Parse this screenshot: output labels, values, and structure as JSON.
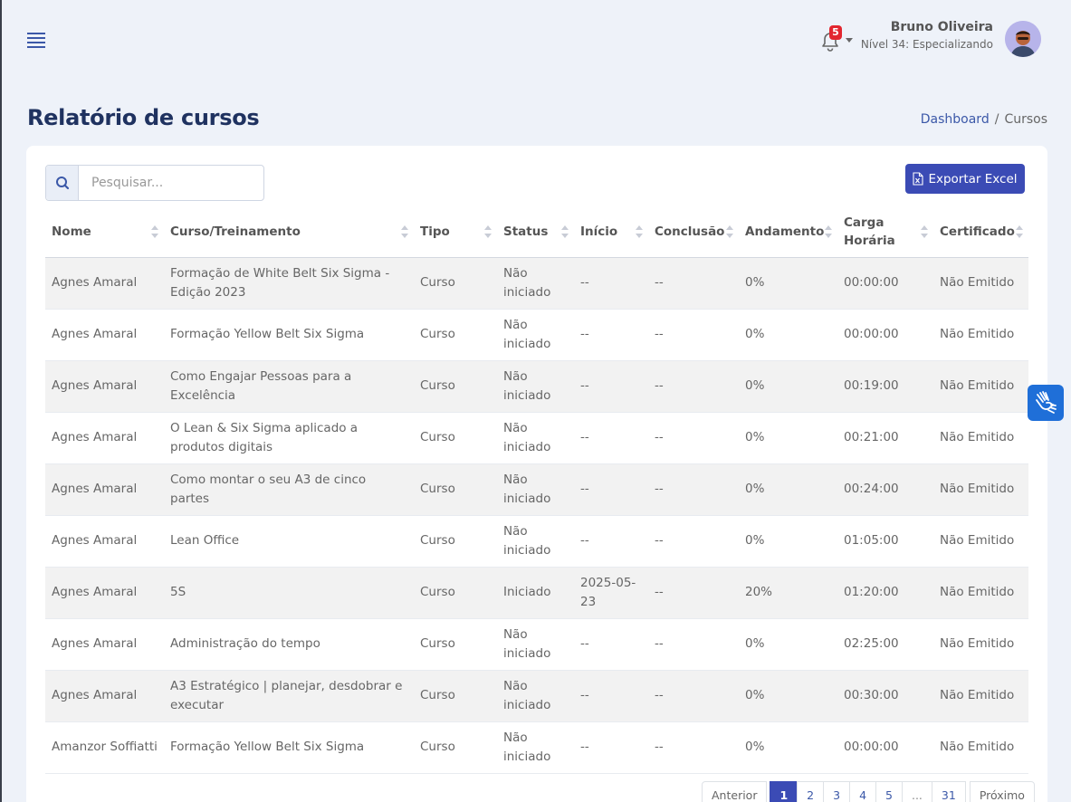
{
  "header": {
    "menu_icon": "hamburger-icon",
    "notifications": {
      "icon": "bell-icon",
      "count": "5"
    },
    "user": {
      "name": "Bruno Oliveira",
      "level": "Nível 34: Especializando"
    }
  },
  "page": {
    "title": "Relatório de cursos",
    "breadcrumb": [
      {
        "label": "Dashboard"
      },
      {
        "label": "Cursos"
      }
    ]
  },
  "search": {
    "placeholder": "Pesquisar...",
    "value": ""
  },
  "export_button": {
    "label": "Exportar Excel",
    "icon": "excel-file-icon"
  },
  "table": {
    "columns": [
      "Nome",
      "Curso/Treinamento",
      "Tipo",
      "Status",
      "Início",
      "Conclusão",
      "Andamento",
      "Carga Horária",
      "Certificado"
    ],
    "rows": [
      [
        "Agnes Amaral",
        "Formação de White Belt Six Sigma - Edição 2023",
        "Curso",
        "Não iniciado",
        "--",
        "--",
        "0%",
        "00:00:00",
        "Não Emitido"
      ],
      [
        "Agnes Amaral",
        "Formação Yellow Belt Six Sigma",
        "Curso",
        "Não iniciado",
        "--",
        "--",
        "0%",
        "00:00:00",
        "Não Emitido"
      ],
      [
        "Agnes Amaral",
        "Como Engajar Pessoas para a Excelência",
        "Curso",
        "Não iniciado",
        "--",
        "--",
        "0%",
        "00:19:00",
        "Não Emitido"
      ],
      [
        "Agnes Amaral",
        "O Lean & Six Sigma aplicado a produtos digitais",
        "Curso",
        "Não iniciado",
        "--",
        "--",
        "0%",
        "00:21:00",
        "Não Emitido"
      ],
      [
        "Agnes Amaral",
        "Como montar o seu A3 de cinco partes",
        "Curso",
        "Não iniciado",
        "--",
        "--",
        "0%",
        "00:24:00",
        "Não Emitido"
      ],
      [
        "Agnes Amaral",
        "Lean Office",
        "Curso",
        "Não iniciado",
        "--",
        "--",
        "0%",
        "01:05:00",
        "Não Emitido"
      ],
      [
        "Agnes Amaral",
        "5S",
        "Curso",
        "Iniciado",
        "2025-05-23",
        "--",
        "20%",
        "01:20:00",
        "Não Emitido"
      ],
      [
        "Agnes Amaral",
        "Administração do tempo",
        "Curso",
        "Não iniciado",
        "--",
        "--",
        "0%",
        "02:25:00",
        "Não Emitido"
      ],
      [
        "Agnes Amaral",
        "A3 Estratégico | planejar, desdobrar e executar",
        "Curso",
        "Não iniciado",
        "--",
        "--",
        "0%",
        "00:30:00",
        "Não Emitido"
      ],
      [
        "Amanzor Soffiatti",
        "Formação Yellow Belt Six Sigma",
        "Curso",
        "Não iniciado",
        "--",
        "--",
        "0%",
        "00:00:00",
        "Não Emitido"
      ]
    ]
  },
  "pagination": {
    "prev": "Anterior",
    "pages": [
      "1",
      "2",
      "3",
      "4",
      "5",
      "...",
      "31"
    ],
    "active": "1",
    "next": "Próximo"
  },
  "accessibility": {
    "icon": "sign-language-hands-icon"
  },
  "colors": {
    "primary": "#3b4bb5",
    "title": "#1f3260",
    "badge": "#e2262f",
    "accessibility": "#1f6fd8"
  }
}
